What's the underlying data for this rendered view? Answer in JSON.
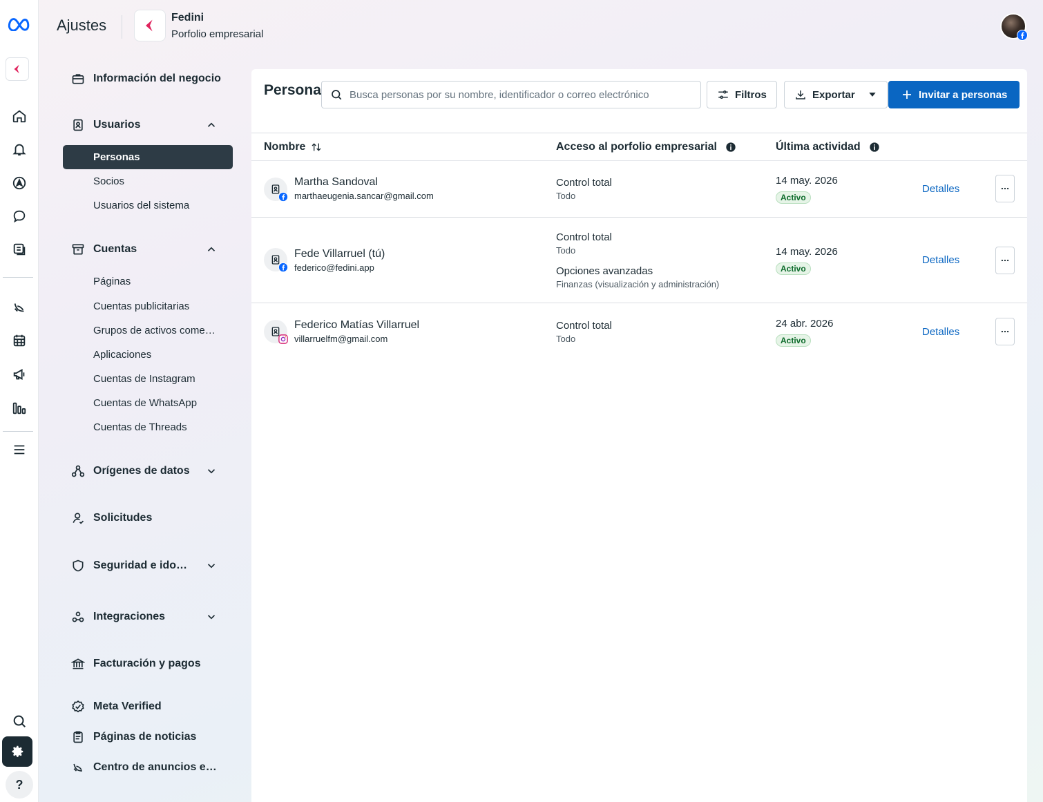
{
  "app": {
    "title": "Ajustes",
    "business_name": "Fedini",
    "business_subtitle": "Porfolio empresarial"
  },
  "rail": {
    "icons": [
      "meta-logo-icon",
      "business-logo-icon",
      "home-icon",
      "bell-icon",
      "compass-icon",
      "chat-icon",
      "content-icon",
      "ads-manager-icon",
      "calendar-icon",
      "megaphone-icon",
      "insights-icon",
      "menu-icon",
      "search-icon",
      "settings-icon",
      "help-icon"
    ],
    "help_label": "?"
  },
  "sidebar": {
    "business_info": "Información del negocio",
    "users": {
      "label": "Usuarios",
      "items": [
        "Personas",
        "Socios",
        "Usuarios del sistema"
      ]
    },
    "accounts": {
      "label": "Cuentas",
      "items": [
        "Páginas",
        "Cuentas publicitarias",
        "Grupos de activos come…",
        "Aplicaciones",
        "Cuentas de Instagram",
        "Cuentas de WhatsApp",
        "Cuentas de Threads"
      ]
    },
    "data_sources": "Orígenes de datos",
    "requests": "Solicitudes",
    "security": "Seguridad e ido…",
    "integrations": "Integraciones",
    "billing": "Facturación y pagos",
    "meta_verified": "Meta Verified",
    "news_pages": "Páginas de noticias",
    "ads_center": "Centro de anuncios e…"
  },
  "main": {
    "title": "Personas",
    "search_placeholder": "Busca personas por su nombre, identificador o correo electrónico",
    "filters_label": "Filtros",
    "export_label": "Exportar",
    "invite_label": "Invitar a personas",
    "columns": {
      "name": "Nombre",
      "access": "Acceso al porfolio empresarial",
      "last_activity": "Última actividad"
    },
    "details_label": "Detalles",
    "rows": [
      {
        "name": "Martha Sandoval",
        "email": "marthaeugenia.sancar@gmail.com",
        "badge": "facebook-icon",
        "access": [
          {
            "title": "Control total",
            "detail": "Todo"
          }
        ],
        "date": "14 may. 2026",
        "status": "Activo"
      },
      {
        "name": "Fede Villarruel (tú)",
        "email": "federico@fedini.app",
        "badge": "facebook-icon",
        "access": [
          {
            "title": "Control total",
            "detail": "Todo"
          },
          {
            "title": "Opciones avanzadas",
            "detail": "Finanzas (visualización y administración)"
          }
        ],
        "date": "14 may. 2026",
        "status": "Activo"
      },
      {
        "name": "Federico Matías Villarruel",
        "email": "villarruelfm@gmail.com",
        "badge": "instagram-icon",
        "access": [
          {
            "title": "Control total",
            "detail": "Todo"
          }
        ],
        "date": "24 abr. 2026",
        "status": "Activo"
      }
    ]
  },
  "colors": {
    "primary": "#0a66c2",
    "active_nav": "#2d3b45",
    "brand_accent": "#e0245e",
    "status_green": "#0d6b2b"
  }
}
